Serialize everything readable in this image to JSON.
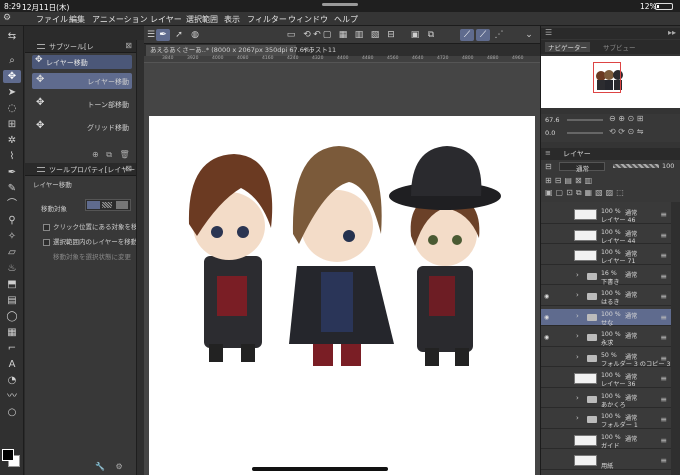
{
  "status": {
    "time": "8:29",
    "date": "12月11日(木)",
    "battery": "12%"
  },
  "menu": [
    "ファイル",
    "編集",
    "アニメーション",
    "レイヤー",
    "選択範囲",
    "表示",
    "フィルター",
    "ウィンドウ",
    "ヘルプ"
  ],
  "subtool": {
    "title": "サブツール[レ",
    "tab": "レイヤー移動",
    "items": [
      "レイヤー移動",
      "トーン部移動",
      "グリッド移動"
    ]
  },
  "toolprop": {
    "title": "ツールプロパティ[レイヤー",
    "name": "レイヤー移動",
    "target_label": "移動対象",
    "options": [
      "クリック位置にある対象を移動",
      "選択範囲内のレイヤーを移動",
      "移動対象を選択状態に変更"
    ]
  },
  "tabs": [
    "あえるあくさーあ..* (8000 x 2067px 350dpi 67.6%)",
    "イラスト11"
  ],
  "ruler": [
    "3840",
    "3920",
    "4000",
    "4080",
    "4160",
    "4240",
    "4320",
    "4400",
    "4480",
    "4560",
    "4640",
    "4720",
    "4800",
    "4880",
    "4960"
  ],
  "navigator": {
    "tab1": "ナビゲーター",
    "tab2": "サブビュー"
  },
  "nav_controls": {
    "zoom": "67.6",
    "angle": "0.0"
  },
  "layer_panel": {
    "title": "レイヤー",
    "blend": "通常",
    "opacity": "100"
  },
  "layers": [
    {
      "pct": "100 %",
      "mode": "通常",
      "name": "レイヤー 46",
      "kind": "raster",
      "eye": false,
      "sel": false
    },
    {
      "pct": "100 %",
      "mode": "通常",
      "name": "レイヤー 44",
      "kind": "raster",
      "eye": false,
      "sel": false
    },
    {
      "pct": "100 %",
      "mode": "通常",
      "name": "レイヤー 71",
      "kind": "raster",
      "eye": false,
      "sel": false
    },
    {
      "pct": "16 %",
      "mode": "通常",
      "name": "下書き",
      "kind": "folder",
      "eye": false,
      "sel": false
    },
    {
      "pct": "100 %",
      "mode": "通常",
      "name": "はるき",
      "kind": "folder",
      "eye": true,
      "sel": false
    },
    {
      "pct": "100 %",
      "mode": "通常",
      "name": "せな",
      "kind": "folder",
      "eye": true,
      "sel": true
    },
    {
      "pct": "100 %",
      "mode": "通常",
      "name": "永求",
      "kind": "folder",
      "eye": true,
      "sel": false
    },
    {
      "pct": "50 %",
      "mode": "通常",
      "name": "フォルダー 3 のコピー 3",
      "kind": "folder",
      "eye": false,
      "sel": false
    },
    {
      "pct": "100 %",
      "mode": "通常",
      "name": "レイヤー 36",
      "kind": "raster",
      "eye": false,
      "sel": false
    },
    {
      "pct": "100 %",
      "mode": "通常",
      "name": "あかくろ",
      "kind": "folder",
      "eye": false,
      "sel": false
    },
    {
      "pct": "100 %",
      "mode": "通常",
      "name": "フォルダー 1",
      "kind": "folder",
      "eye": false,
      "sel": false
    },
    {
      "pct": "100 %",
      "mode": "通常",
      "name": "ガイド",
      "kind": "raster",
      "eye": false,
      "sel": false
    },
    {
      "pct": "",
      "mode": "",
      "name": "用紙",
      "kind": "raster",
      "eye": false,
      "sel": false
    }
  ],
  "colors": {
    "accent": "#5f6b8e",
    "panel": "#383838",
    "bg": "#2b2b2b"
  }
}
